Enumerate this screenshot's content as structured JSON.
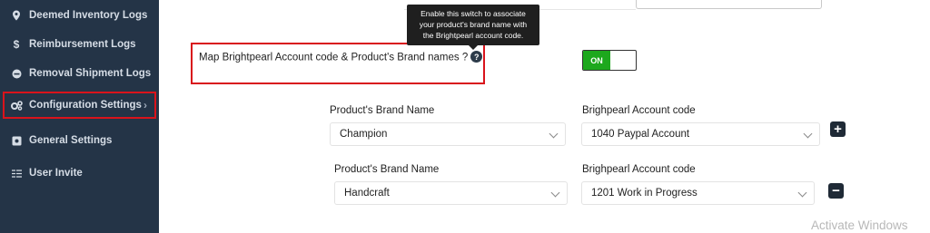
{
  "sidebar": {
    "items": [
      {
        "label": "Deemed Inventory Logs",
        "icon": "map-pin-icon"
      },
      {
        "label": "Reimbursement Logs",
        "icon": "dollar-icon"
      },
      {
        "label": "Removal Shipment Logs",
        "icon": "minus-circle-icon"
      },
      {
        "label": "Configuration Settings",
        "icon": "gears-icon",
        "chevron": "›"
      },
      {
        "label": "General Settings",
        "icon": "settings-box-icon"
      },
      {
        "label": "User Invite",
        "icon": "user-list-icon"
      }
    ]
  },
  "tooltip": {
    "line1": "Enable this switch to associate",
    "line2": "your product's brand name with",
    "line3": "the Brightpearl account code."
  },
  "mapping": {
    "label": "Map Brightpearl Account code & Product's Brand names ?",
    "help": "?",
    "toggle": "ON"
  },
  "rows": [
    {
      "brand_label": "Product's Brand Name",
      "brand_value": "Champion",
      "code_label": "Brighpearl Account code",
      "code_value": "1040 Paypal Account",
      "action": "+"
    },
    {
      "brand_label": "Product's Brand Name",
      "brand_value": "Handcraft",
      "code_label": "Brighpearl Account code",
      "code_value": "1201 Work in Progress",
      "action": "−"
    }
  ],
  "watermark": "Activate Windows",
  "colors": {
    "sidebar": "#243447",
    "highlight": "#d9131b",
    "toggle_on": "#1da81d"
  }
}
